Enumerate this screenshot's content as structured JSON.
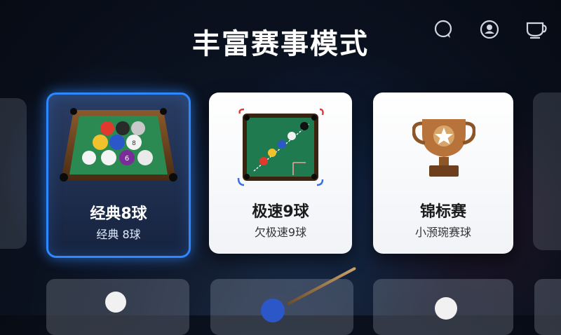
{
  "header": {
    "title": "丰富赛事模式"
  },
  "top_icons": [
    {
      "name": "chat-icon"
    },
    {
      "name": "profile-icon"
    },
    {
      "name": "cup-icon"
    }
  ],
  "modes": [
    {
      "title": "经典8球",
      "subtitle": "经典 8球",
      "selected": true
    },
    {
      "title": "极速9球",
      "subtitle": "⽋极速9球",
      "selected": false
    },
    {
      "title": "锦标赛",
      "subtitle": "小滪琬赛球",
      "selected": false
    }
  ],
  "colors": {
    "accent": "#2f88ff",
    "table_green": "#1f7a4f",
    "trophy": "#b8733a"
  }
}
